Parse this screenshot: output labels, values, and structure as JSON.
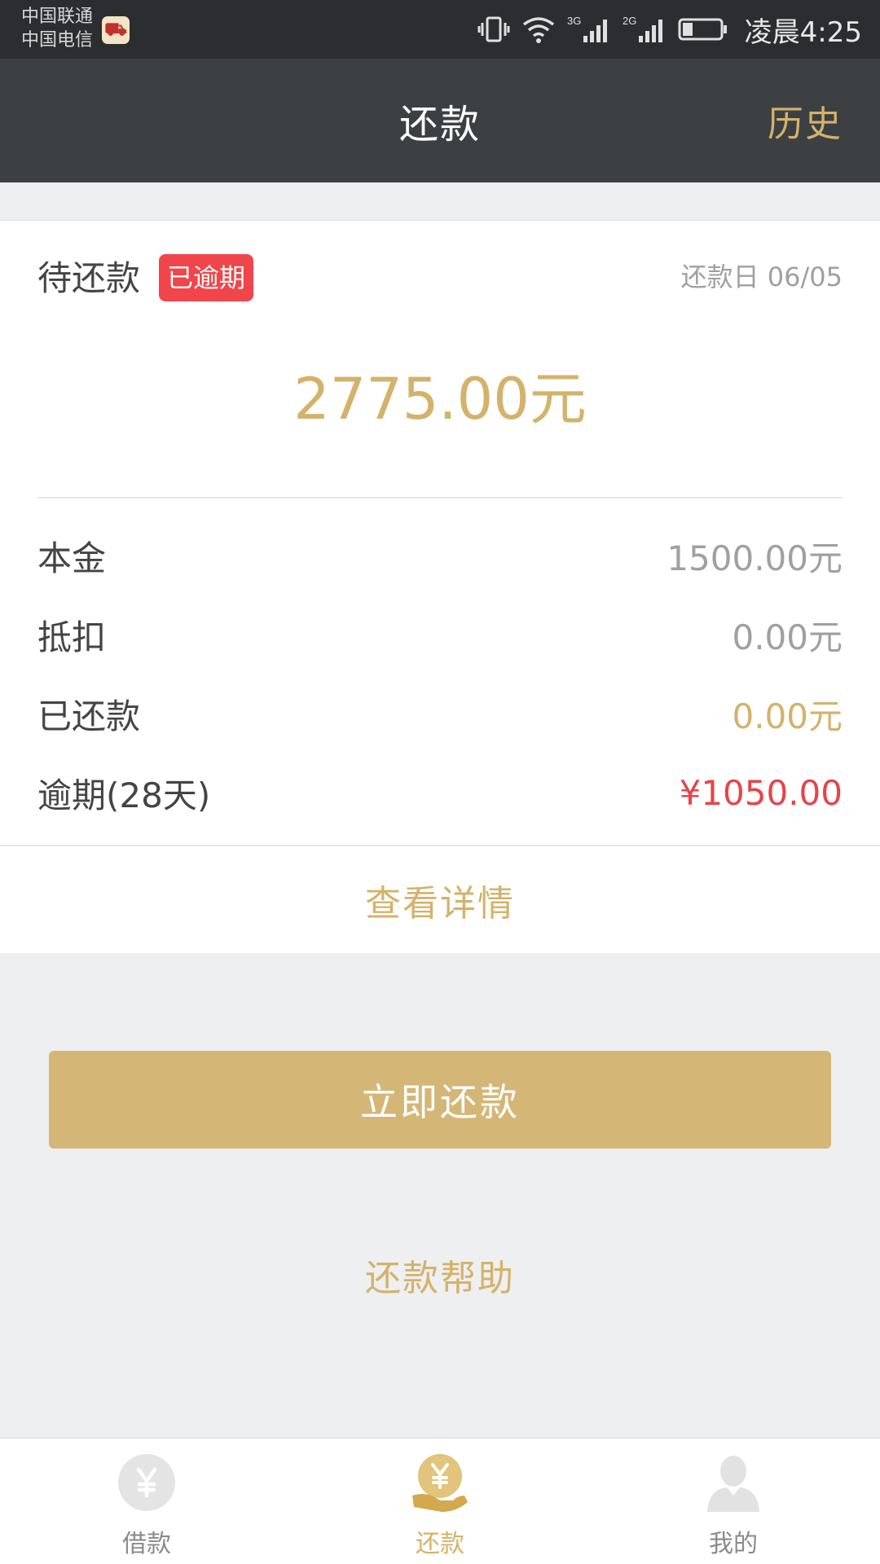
{
  "status_bar": {
    "carrier_1": "中国联通",
    "carrier_2": "中国电信",
    "network_1": "3G",
    "network_2": "2G",
    "time": "凌晨4:25"
  },
  "header": {
    "title": "还款",
    "history_label": "历史"
  },
  "card": {
    "pending_label": "待还款",
    "overdue_badge": "已逾期",
    "due_date": "还款日  06/05",
    "total_amount": "2775.00元",
    "rows": [
      {
        "label": "本金",
        "value": "1500.00元"
      },
      {
        "label": "抵扣",
        "value": "0.00元"
      },
      {
        "label": "已还款",
        "value": "0.00元"
      },
      {
        "label": "逾期(28天)",
        "value": "¥1050.00"
      }
    ],
    "view_details_label": "查看详情"
  },
  "actions": {
    "repay_now_label": "立即还款",
    "repay_help_label": "还款帮助"
  },
  "tabs": [
    {
      "label": "借款",
      "icon": "yen-coin-icon",
      "active": false
    },
    {
      "label": "还款",
      "icon": "repay-hand-icon",
      "active": true
    },
    {
      "label": "我的",
      "icon": "user-icon",
      "active": false
    }
  ],
  "colors": {
    "accent_gold": "#d4b26a",
    "overdue_red": "#e8434a",
    "header_bg": "#3c4043",
    "status_bar_bg": "#2b2d30"
  }
}
